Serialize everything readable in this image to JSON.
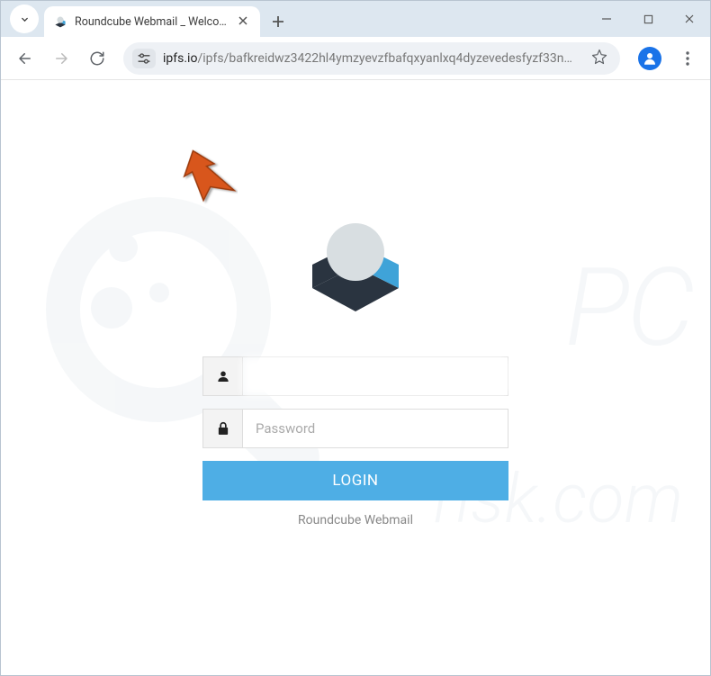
{
  "tab": {
    "title": "Roundcube Webmail _ Welcom"
  },
  "address": {
    "domain": "ipfs.io",
    "path": "/ipfs/bafkreidwz3422hl4ymzyevzfbafqxyanlxq4dyzevedesfyzf33n…"
  },
  "form": {
    "username_value": "",
    "password_placeholder": "Password",
    "login_label": "LOGIN",
    "caption": "Roundcube Webmail"
  },
  "watermark": {
    "line1": "PC",
    "line2": "risk.com"
  }
}
